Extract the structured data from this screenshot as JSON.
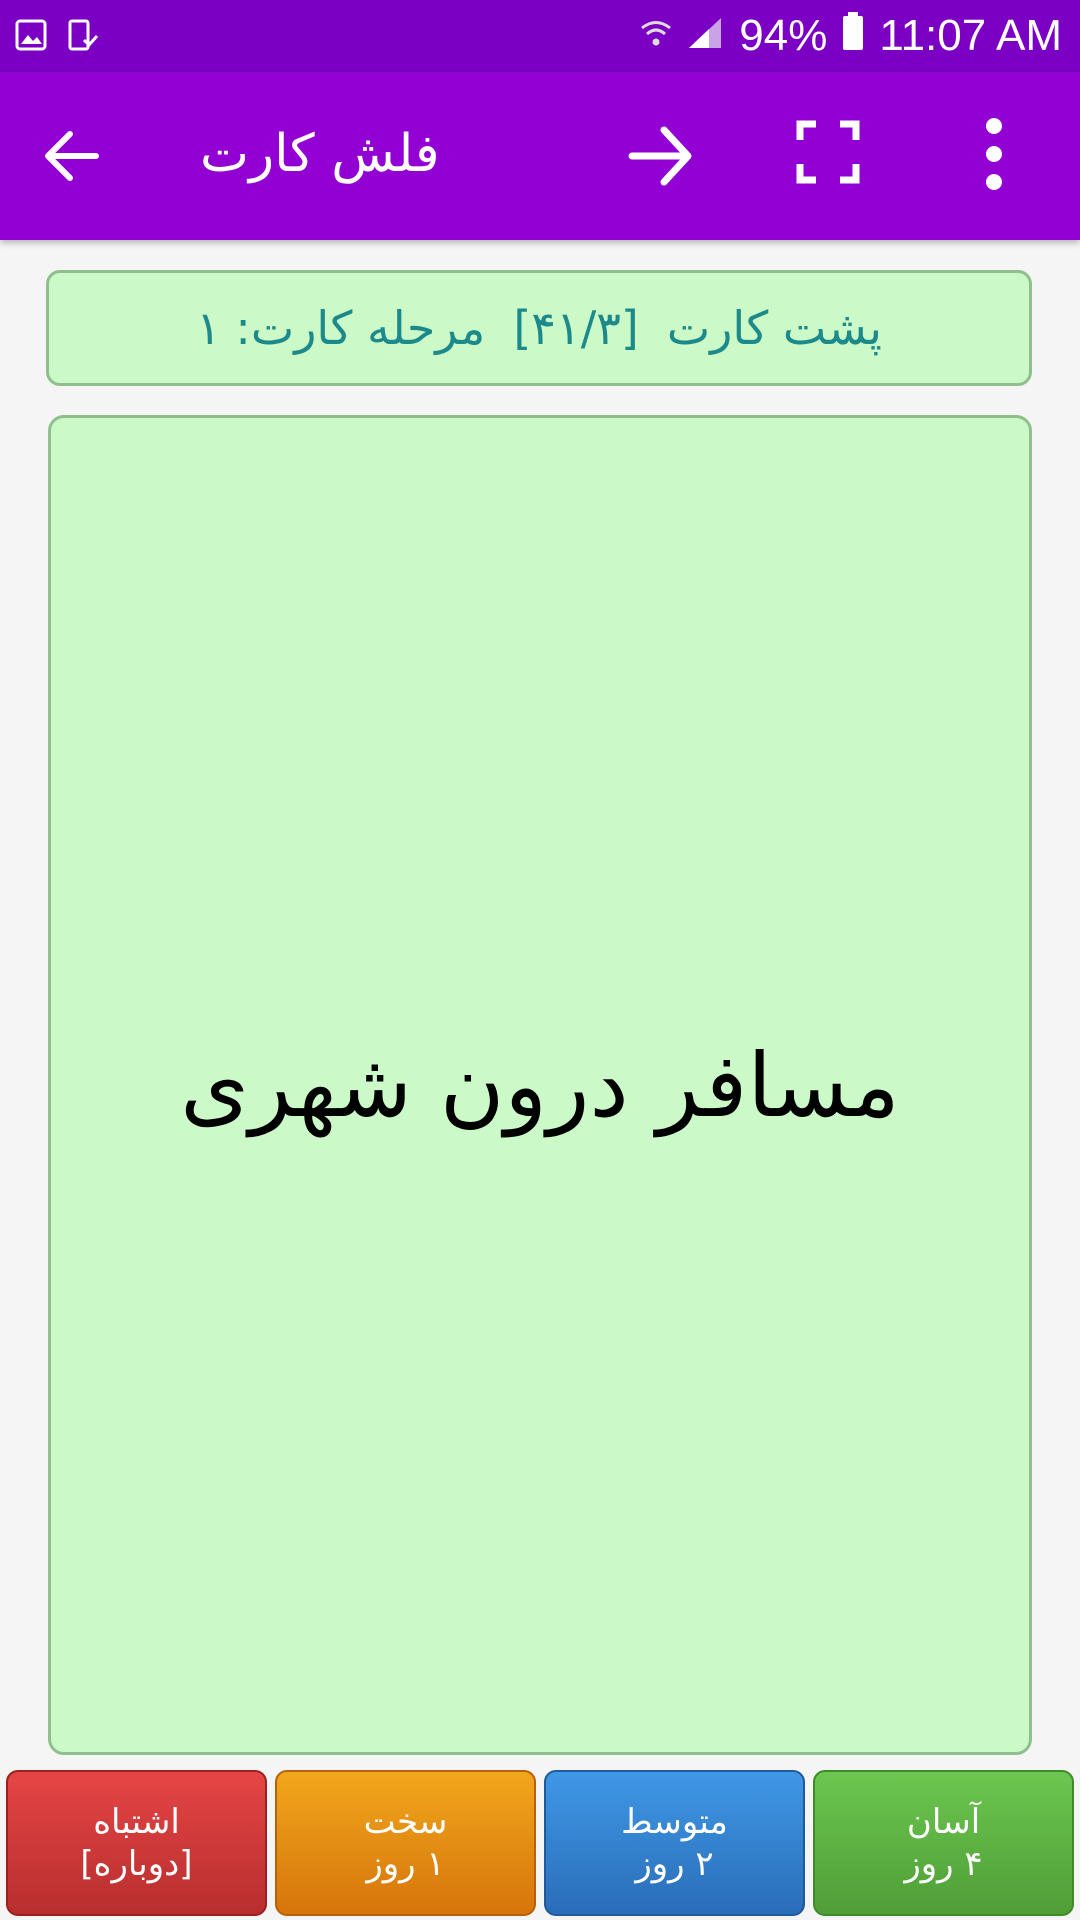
{
  "status_bar": {
    "time": "11:07 AM",
    "battery": "94%",
    "icons": [
      "gallery-icon",
      "download-done-icon",
      "wifi-icon",
      "signal-icon",
      "battery-icon"
    ]
  },
  "app_bar": {
    "title": "فلش کارت",
    "icons": [
      "back-arrow-icon",
      "forward-arrow-icon",
      "fullscreen-icon",
      "more-vert-icon"
    ]
  },
  "card_header": {
    "side": "پشت کارت",
    "position": "[۴۱/۳]",
    "stage": "مرحله کارت: ۱"
  },
  "card": {
    "text": "مسافر درون شهری"
  },
  "answer_buttons": [
    {
      "label": "اشتباه",
      "sub": "[دوباره]",
      "color": "#d63a3a"
    },
    {
      "label": "سخت",
      "sub": "۱ روز",
      "color": "#e88d12"
    },
    {
      "label": "متوسط",
      "sub": "۲ روز",
      "color": "#3583d0"
    },
    {
      "label": "آسان",
      "sub": "۴ روز",
      "color": "#5cb544"
    }
  ],
  "colors": {
    "status_bar": "#7b00c4",
    "app_bar": "#9300d4",
    "card_background": "#ccf9c8",
    "header_text": "#1c8a8a"
  }
}
